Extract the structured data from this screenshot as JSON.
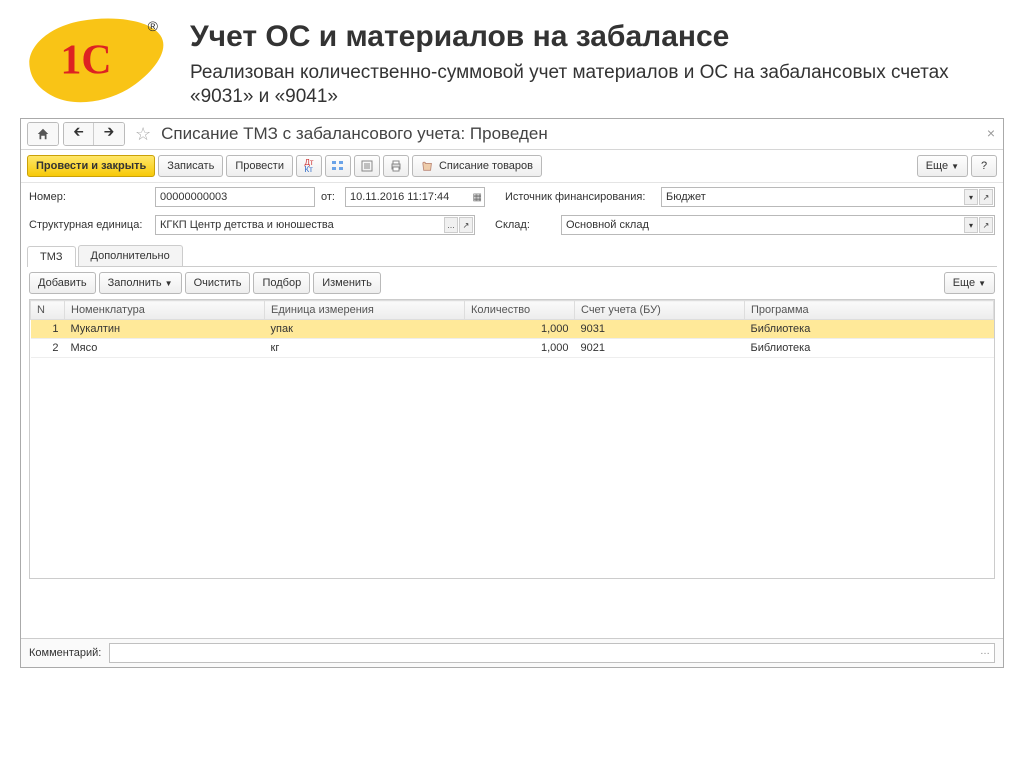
{
  "page": {
    "title": "Учет ОС и материалов на забалансе",
    "subtitle": "Реализован количественно-суммовой учет материалов и ОС на забалансовых счетах «9031» и «9041»"
  },
  "doc": {
    "title": "Списание ТМЗ с забалансового учета: Проведен"
  },
  "toolbar": {
    "postAndClose": "Провести и закрыть",
    "write": "Записать",
    "post": "Провести",
    "writeoff": "Списание товаров",
    "more": "Еще",
    "help": "?"
  },
  "form": {
    "numberLabel": "Номер:",
    "numberValue": "00000000003",
    "dateLabel": "от:",
    "dateValue": "10.11.2016 11:17:44",
    "sourceLabel": "Источник финансирования:",
    "sourceValue": "Бюджет",
    "unitLabel": "Структурная единица:",
    "unitValue": "КГКП Центр детства и юношества",
    "warehouseLabel": "Склад:",
    "warehouseValue": "Основной склад"
  },
  "tabs": {
    "tmz": "ТМЗ",
    "additional": "Дополнительно"
  },
  "subtoolbar": {
    "add": "Добавить",
    "fill": "Заполнить",
    "clear": "Очистить",
    "pick": "Подбор",
    "change": "Изменить",
    "more": "Еще"
  },
  "grid": {
    "headers": {
      "n": "N",
      "nomen": "Номенклатура",
      "unit": "Единица измерения",
      "qty": "Количество",
      "account": "Счет учета (БУ)",
      "program": "Программа"
    },
    "rows": [
      {
        "n": "1",
        "nomen": "Мукалтин",
        "unit": "упак",
        "qty": "1,000",
        "account": "9031",
        "program": "Библиотека"
      },
      {
        "n": "2",
        "nomen": "Мясо",
        "unit": "кг",
        "qty": "1,000",
        "account": "9021",
        "program": "Библиотека"
      }
    ]
  },
  "comment": {
    "label": "Комментарий:"
  }
}
